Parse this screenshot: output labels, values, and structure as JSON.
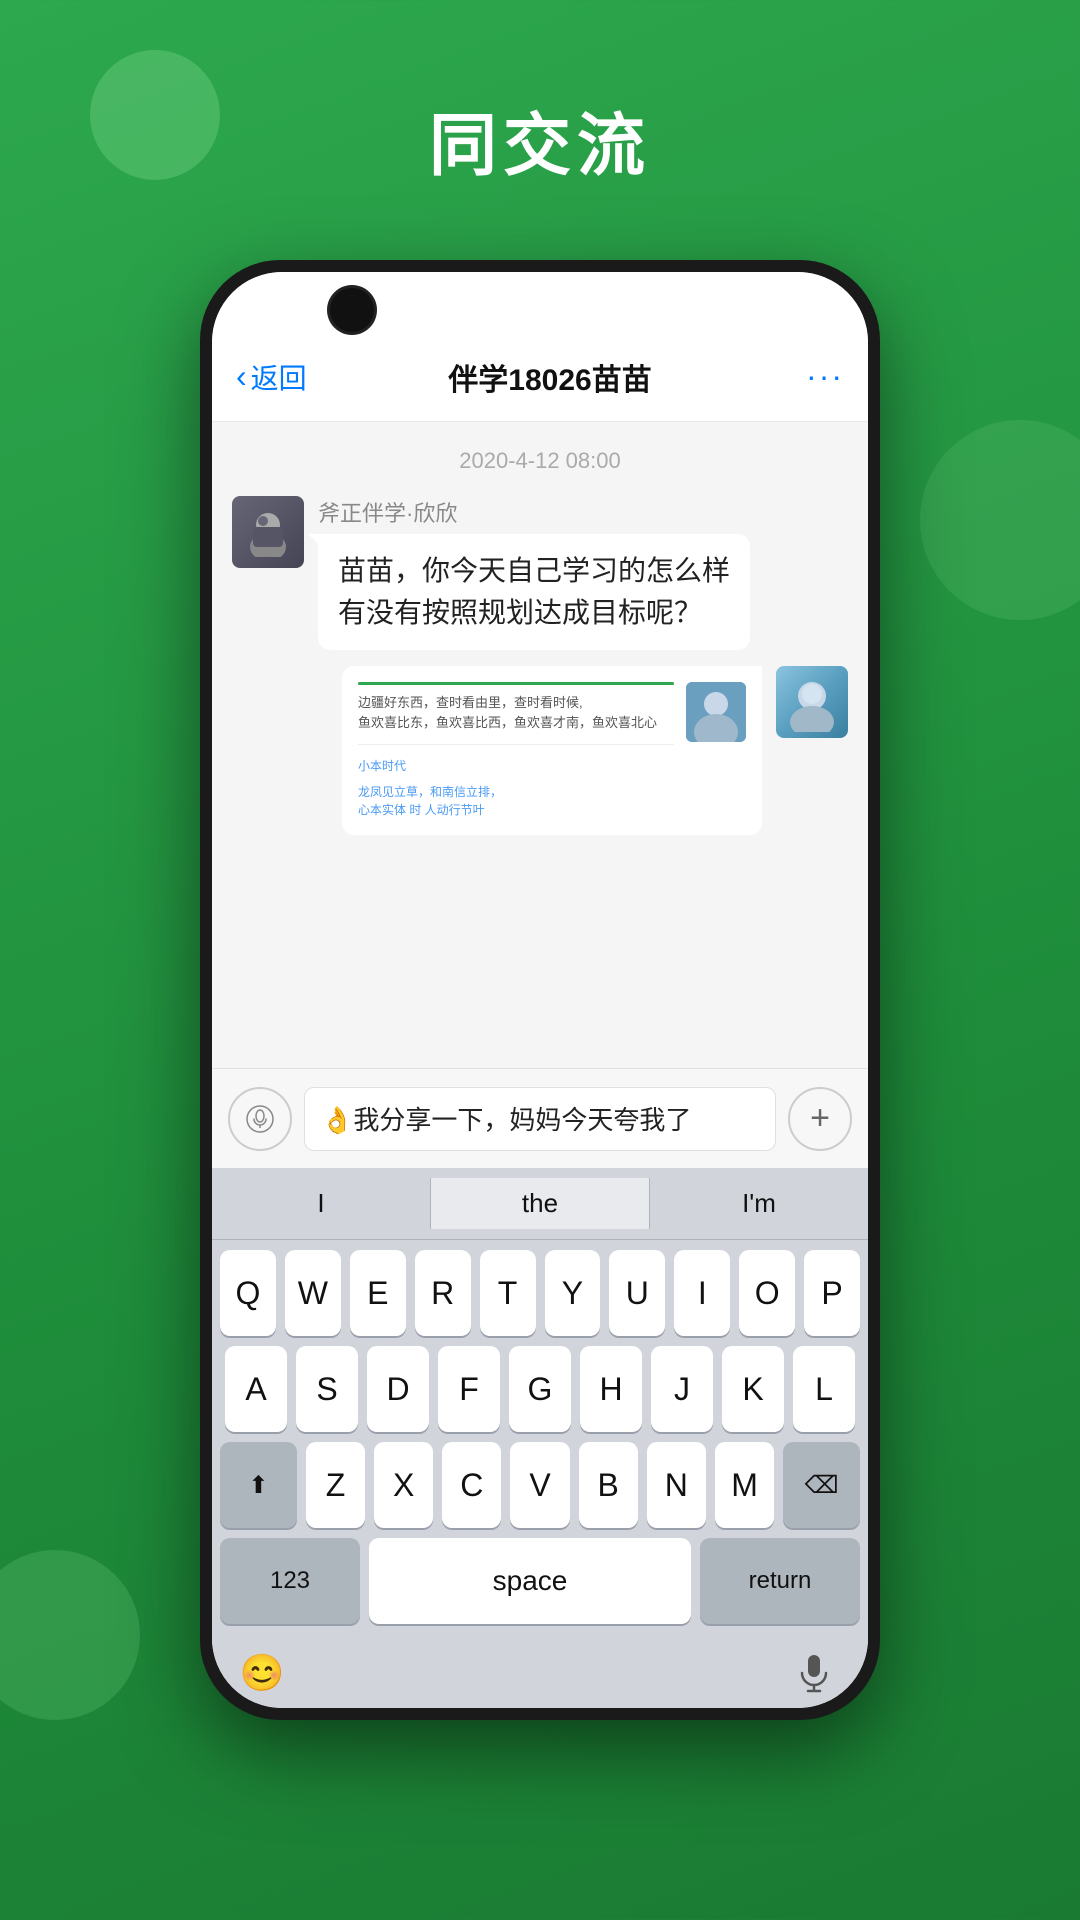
{
  "background": {
    "color": "#2da84e"
  },
  "page_title": "同交流",
  "phone": {
    "nav": {
      "back_label": "返回",
      "title": "伴学18026苗苗",
      "more_icon": "···"
    },
    "chat": {
      "timestamp": "2020-4-12  08:00",
      "messages": [
        {
          "id": "msg1",
          "side": "left",
          "sender": "斧正伴学·欣欣",
          "text": "苗苗，你今天自己学习的怎么样\n有没有按照规划达成目标呢？",
          "has_note": true
        }
      ]
    },
    "input": {
      "message_text": "👌我分享一下，妈妈今天夸我了",
      "voice_icon": "📢",
      "add_icon": "+"
    },
    "keyboard": {
      "suggestions": [
        "I",
        "the",
        "I'm"
      ],
      "rows": [
        [
          "Q",
          "W",
          "E",
          "R",
          "T",
          "Y",
          "U",
          "I",
          "O",
          "P"
        ],
        [
          "A",
          "S",
          "D",
          "F",
          "G",
          "H",
          "J",
          "K",
          "L"
        ],
        [
          "Z",
          "X",
          "C",
          "V",
          "B",
          "N",
          "M"
        ]
      ],
      "shift_icon": "⬆",
      "delete_icon": "⌫",
      "key_123": "123",
      "key_space": "space",
      "key_return": "return",
      "emoji_icon": "😊",
      "mic_icon": "🎤"
    }
  }
}
